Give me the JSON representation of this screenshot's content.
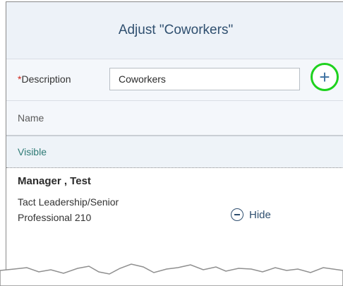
{
  "dialog": {
    "title": "Adjust \"Coworkers\""
  },
  "description": {
    "required_mark": "*",
    "label": "Description",
    "value": "Coworkers",
    "add_icon": "plus-icon"
  },
  "table": {
    "column_header": "Name",
    "group_header": "Visible",
    "rows": [
      {
        "name": "Manager , Test",
        "title": "Tact Leadership/Senior Professional 210",
        "action_label": "Hide",
        "action_icon": "circle-minus-icon"
      }
    ]
  },
  "colors": {
    "accent": "#2f4f6f",
    "highlight": "#1ed21e",
    "group": "#2f7b76",
    "required": "#d0271d"
  }
}
